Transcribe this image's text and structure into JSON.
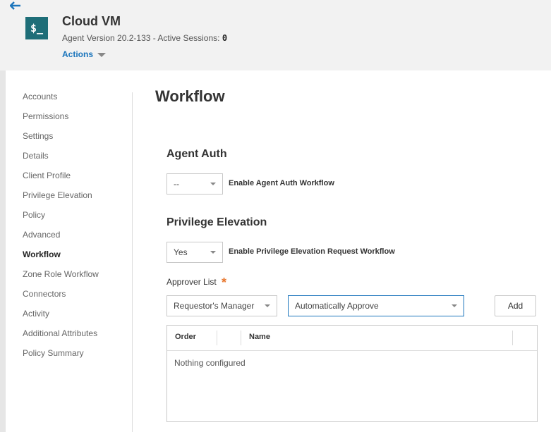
{
  "header": {
    "title": "Cloud VM",
    "icon_text": "$_",
    "agent_version_label": "Agent Version 20.2-133 - Active Sessions:",
    "active_sessions": "0",
    "actions_label": "Actions"
  },
  "sidebar": {
    "items": [
      {
        "label": "Accounts"
      },
      {
        "label": "Permissions"
      },
      {
        "label": "Settings"
      },
      {
        "label": "Details"
      },
      {
        "label": "Client Profile"
      },
      {
        "label": "Privilege Elevation"
      },
      {
        "label": "Policy"
      },
      {
        "label": "Advanced"
      },
      {
        "label": "Workflow",
        "active": true
      },
      {
        "label": "Zone Role Workflow"
      },
      {
        "label": "Connectors"
      },
      {
        "label": "Activity"
      },
      {
        "label": "Additional Attributes"
      },
      {
        "label": "Policy Summary"
      }
    ]
  },
  "main": {
    "title": "Workflow",
    "agent_auth": {
      "heading": "Agent Auth",
      "select_value": "--",
      "label": "Enable Agent Auth Workflow"
    },
    "privilege_elevation": {
      "heading": "Privilege Elevation",
      "select_value": "Yes",
      "label": "Enable Privilege Elevation Request Workflow"
    },
    "approver_list": {
      "label": "Approver List",
      "required_mark": "*",
      "approver_select": "Requestor's Manager",
      "approval_select": "Automatically Approve",
      "add_label": "Add",
      "columns": [
        "Order",
        "Name"
      ],
      "empty_text": "Nothing configured"
    }
  },
  "colors": {
    "accent": "#1b75bc",
    "icon_bg": "#1e6e78",
    "required": "#e8772e"
  }
}
